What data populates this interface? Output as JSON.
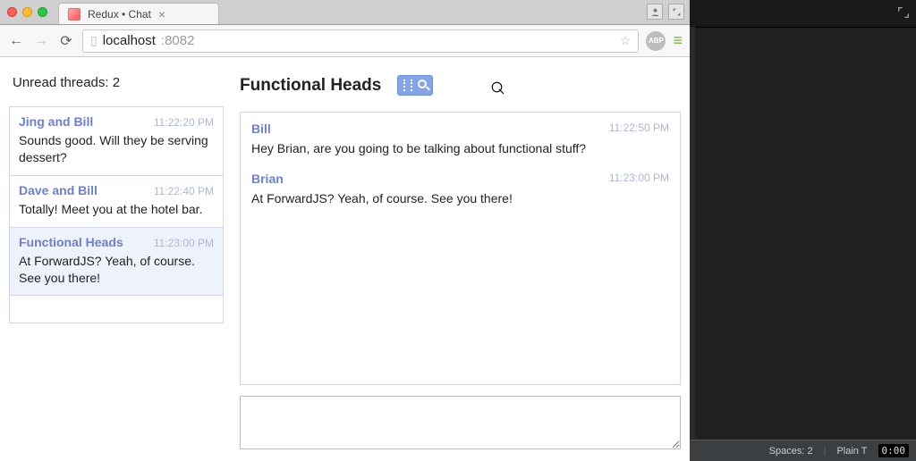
{
  "browser": {
    "tab_title": "Redux • Chat",
    "url_host": "localhost",
    "url_port": ":8082",
    "abp": "ABP"
  },
  "app": {
    "unread_label": "Unread threads:",
    "unread_count": "2",
    "threads": [
      {
        "name": "Jing and Bill",
        "time": "11:22:20 PM",
        "preview": "Sounds good. Will they be serving dessert?",
        "selected": false
      },
      {
        "name": "Dave and Bill",
        "time": "11:22:40 PM",
        "preview": "Totally! Meet you at the hotel bar.",
        "selected": false
      },
      {
        "name": "Functional Heads",
        "time": "11:23:00 PM",
        "preview": "At ForwardJS? Yeah, of course. See you there!",
        "selected": true
      }
    ],
    "current_thread_title": "Functional Heads",
    "messages": [
      {
        "author": "Bill",
        "time": "11:22:50 PM",
        "body": "Hey Brian, are you going to be talking about functional stuff?"
      },
      {
        "author": "Brian",
        "time": "11:23:00 PM",
        "body": "At ForwardJS? Yeah, of course. See you there!"
      }
    ],
    "composer_value": ""
  },
  "editor": {
    "spaces": "Spaces: 2",
    "syntax": "Plain T",
    "clock": "0:00"
  }
}
